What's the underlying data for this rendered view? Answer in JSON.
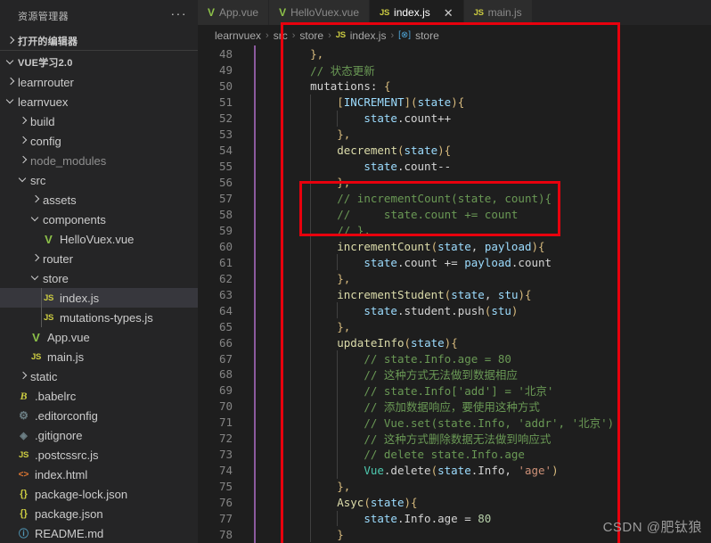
{
  "sidebar": {
    "header_title": "资源管理器",
    "dots_label": "···",
    "open_editors_label": "打开的编辑器",
    "project_label": "VUE学习2.0",
    "tree": [
      {
        "label": "learnrouter",
        "depth": 1,
        "kind": "folder",
        "state": "collapsed"
      },
      {
        "label": "learnvuex",
        "depth": 1,
        "kind": "folder",
        "state": "expanded"
      },
      {
        "label": "build",
        "depth": 2,
        "kind": "folder",
        "state": "collapsed"
      },
      {
        "label": "config",
        "depth": 2,
        "kind": "folder",
        "state": "collapsed"
      },
      {
        "label": "node_modules",
        "depth": 2,
        "kind": "folder",
        "state": "collapsed",
        "dim": true
      },
      {
        "label": "src",
        "depth": 2,
        "kind": "folder",
        "state": "expanded"
      },
      {
        "label": "assets",
        "depth": 3,
        "kind": "folder",
        "state": "collapsed"
      },
      {
        "label": "components",
        "depth": 3,
        "kind": "folder",
        "state": "expanded"
      },
      {
        "label": "HelloVuex.vue",
        "depth": 4,
        "kind": "file",
        "icon": "vue"
      },
      {
        "label": "router",
        "depth": 3,
        "kind": "folder",
        "state": "collapsed"
      },
      {
        "label": "store",
        "depth": 3,
        "kind": "folder",
        "state": "expanded"
      },
      {
        "label": "index.js",
        "depth": 4,
        "kind": "file",
        "icon": "js",
        "selected": true
      },
      {
        "label": "mutations-types.js",
        "depth": 4,
        "kind": "file",
        "icon": "js"
      },
      {
        "label": "App.vue",
        "depth": 3,
        "kind": "file",
        "icon": "vue"
      },
      {
        "label": "main.js",
        "depth": 3,
        "kind": "file",
        "icon": "js"
      },
      {
        "label": "static",
        "depth": 2,
        "kind": "folder",
        "state": "collapsed"
      },
      {
        "label": ".babelrc",
        "depth": 2,
        "kind": "file",
        "icon": "babel"
      },
      {
        "label": ".editorconfig",
        "depth": 2,
        "kind": "file",
        "icon": "gear"
      },
      {
        "label": ".gitignore",
        "depth": 2,
        "kind": "file",
        "icon": "git"
      },
      {
        "label": ".postcssrc.js",
        "depth": 2,
        "kind": "file",
        "icon": "js"
      },
      {
        "label": "index.html",
        "depth": 2,
        "kind": "file",
        "icon": "html"
      },
      {
        "label": "package-lock.json",
        "depth": 2,
        "kind": "file",
        "icon": "json"
      },
      {
        "label": "package.json",
        "depth": 2,
        "kind": "file",
        "icon": "json"
      },
      {
        "label": "README.md",
        "depth": 2,
        "kind": "file",
        "icon": "md"
      }
    ],
    "icon_glyphs": {
      "js": "JS",
      "vue": "V",
      "babel": "B",
      "gear": "⚙",
      "git": "◈",
      "html": "<>",
      "json": "{}",
      "md": "ⓘ"
    }
  },
  "tabs": [
    {
      "label": "App.vue",
      "icon": "vue",
      "icon_glyph": "V",
      "active": false,
      "closable": false
    },
    {
      "label": "HelloVuex.vue",
      "icon": "vue",
      "icon_glyph": "V",
      "active": false,
      "closable": false
    },
    {
      "label": "index.js",
      "icon": "js",
      "icon_glyph": "JS",
      "active": true,
      "closable": true,
      "close_glyph": "✕"
    },
    {
      "label": "main.js",
      "icon": "js",
      "icon_glyph": "JS",
      "active": false,
      "closable": false
    }
  ],
  "breadcrumb": {
    "items": [
      "learnvuex",
      "src",
      "store",
      "index.js",
      "store"
    ],
    "separator": "›",
    "file_icon_glyph": "JS",
    "symbol_icon_glyph": "[⊗]"
  },
  "editor": {
    "first_line": 48,
    "last_line": 78,
    "lines": [
      {
        "n": 48,
        "indent": 2,
        "tokens": [
          {
            "t": "},",
            "c": "c-brace"
          }
        ]
      },
      {
        "n": 49,
        "indent": 2,
        "tokens": [
          {
            "t": "// 状态更新",
            "c": "c-com"
          }
        ]
      },
      {
        "n": 50,
        "indent": 2,
        "tokens": [
          {
            "t": "mutations",
            "c": "c-plain"
          },
          {
            "t": ": ",
            "c": "c-plain"
          },
          {
            "t": "{",
            "c": "c-brace"
          }
        ]
      },
      {
        "n": 51,
        "indent": 3,
        "tokens": [
          {
            "t": "[",
            "c": "c-brace"
          },
          {
            "t": "INCREMENT",
            "c": "c-var"
          },
          {
            "t": "]",
            "c": "c-brace"
          },
          {
            "t": "(",
            "c": "c-brace"
          },
          {
            "t": "state",
            "c": "c-var"
          },
          {
            "t": ")",
            "c": "c-brace"
          },
          {
            "t": "{",
            "c": "c-brace"
          }
        ]
      },
      {
        "n": 52,
        "indent": 4,
        "tokens": [
          {
            "t": "state",
            "c": "c-var"
          },
          {
            "t": ".count++",
            "c": "c-plain"
          }
        ]
      },
      {
        "n": 53,
        "indent": 3,
        "tokens": [
          {
            "t": "},",
            "c": "c-brace"
          }
        ]
      },
      {
        "n": 54,
        "indent": 3,
        "tokens": [
          {
            "t": "decrement",
            "c": "c-func"
          },
          {
            "t": "(",
            "c": "c-brace"
          },
          {
            "t": "state",
            "c": "c-var"
          },
          {
            "t": ")",
            "c": "c-brace"
          },
          {
            "t": "{",
            "c": "c-brace"
          }
        ]
      },
      {
        "n": 55,
        "indent": 4,
        "tokens": [
          {
            "t": "state",
            "c": "c-var"
          },
          {
            "t": ".count--",
            "c": "c-plain"
          }
        ]
      },
      {
        "n": 56,
        "indent": 3,
        "tokens": [
          {
            "t": "},",
            "c": "c-brace"
          }
        ]
      },
      {
        "n": 57,
        "indent": 3,
        "tokens": [
          {
            "t": "// incrementCount(state, count){",
            "c": "c-com"
          }
        ]
      },
      {
        "n": 58,
        "indent": 3,
        "tokens": [
          {
            "t": "//     state.count += count",
            "c": "c-com"
          }
        ]
      },
      {
        "n": 59,
        "indent": 3,
        "tokens": [
          {
            "t": "// },",
            "c": "c-com"
          }
        ]
      },
      {
        "n": 60,
        "indent": 3,
        "tokens": [
          {
            "t": "incrementCount",
            "c": "c-func"
          },
          {
            "t": "(",
            "c": "c-brace"
          },
          {
            "t": "state",
            "c": "c-var"
          },
          {
            "t": ", ",
            "c": "c-plain"
          },
          {
            "t": "payload",
            "c": "c-var"
          },
          {
            "t": ")",
            "c": "c-brace"
          },
          {
            "t": "{",
            "c": "c-brace"
          }
        ]
      },
      {
        "n": 61,
        "indent": 4,
        "tokens": [
          {
            "t": "state",
            "c": "c-var"
          },
          {
            "t": ".count += ",
            "c": "c-plain"
          },
          {
            "t": "payload",
            "c": "c-var"
          },
          {
            "t": ".count",
            "c": "c-plain"
          }
        ]
      },
      {
        "n": 62,
        "indent": 3,
        "tokens": [
          {
            "t": "},",
            "c": "c-brace"
          }
        ]
      },
      {
        "n": 63,
        "indent": 3,
        "tokens": [
          {
            "t": "incrementStudent",
            "c": "c-func"
          },
          {
            "t": "(",
            "c": "c-brace"
          },
          {
            "t": "state",
            "c": "c-var"
          },
          {
            "t": ", ",
            "c": "c-plain"
          },
          {
            "t": "stu",
            "c": "c-var"
          },
          {
            "t": ")",
            "c": "c-brace"
          },
          {
            "t": "{",
            "c": "c-brace"
          }
        ]
      },
      {
        "n": 64,
        "indent": 4,
        "tokens": [
          {
            "t": "state",
            "c": "c-var"
          },
          {
            "t": ".student.",
            "c": "c-plain"
          },
          {
            "t": "push",
            "c": "c-plain"
          },
          {
            "t": "(",
            "c": "c-brace"
          },
          {
            "t": "stu",
            "c": "c-var"
          },
          {
            "t": ")",
            "c": "c-brace"
          }
        ]
      },
      {
        "n": 65,
        "indent": 3,
        "tokens": [
          {
            "t": "},",
            "c": "c-brace"
          }
        ]
      },
      {
        "n": 66,
        "indent": 3,
        "tokens": [
          {
            "t": "updateInfo",
            "c": "c-func"
          },
          {
            "t": "(",
            "c": "c-brace"
          },
          {
            "t": "state",
            "c": "c-var"
          },
          {
            "t": ")",
            "c": "c-brace"
          },
          {
            "t": "{",
            "c": "c-brace"
          }
        ]
      },
      {
        "n": 67,
        "indent": 4,
        "tokens": [
          {
            "t": "// state.Info.age = 80",
            "c": "c-com"
          }
        ]
      },
      {
        "n": 68,
        "indent": 4,
        "tokens": [
          {
            "t": "// 这种方式无法做到数据相应",
            "c": "c-com"
          }
        ]
      },
      {
        "n": 69,
        "indent": 4,
        "tokens": [
          {
            "t": "// state.Info['add'] = '北京'",
            "c": "c-com"
          }
        ]
      },
      {
        "n": 70,
        "indent": 4,
        "tokens": [
          {
            "t": "// 添加数据响应，要使用这种方式",
            "c": "c-com"
          }
        ]
      },
      {
        "n": 71,
        "indent": 4,
        "tokens": [
          {
            "t": "// Vue.set(state.Info, 'addr', '北京')",
            "c": "c-com"
          }
        ]
      },
      {
        "n": 72,
        "indent": 4,
        "tokens": [
          {
            "t": "// 这种方式删除数据无法做到响应式",
            "c": "c-com"
          }
        ]
      },
      {
        "n": 73,
        "indent": 4,
        "tokens": [
          {
            "t": "// delete state.Info.age",
            "c": "c-com"
          }
        ]
      },
      {
        "n": 74,
        "indent": 4,
        "tokens": [
          {
            "t": "Vue",
            "c": "c-cls"
          },
          {
            "t": ".",
            "c": "c-plain"
          },
          {
            "t": "delete",
            "c": "c-plain"
          },
          {
            "t": "(",
            "c": "c-brace"
          },
          {
            "t": "state",
            "c": "c-var"
          },
          {
            "t": ".Info, ",
            "c": "c-plain"
          },
          {
            "t": "'age'",
            "c": "c-str"
          },
          {
            "t": ")",
            "c": "c-brace"
          }
        ]
      },
      {
        "n": 75,
        "indent": 3,
        "tokens": [
          {
            "t": "},",
            "c": "c-brace"
          }
        ]
      },
      {
        "n": 76,
        "indent": 3,
        "tokens": [
          {
            "t": "Asyc",
            "c": "c-func"
          },
          {
            "t": "(",
            "c": "c-brace"
          },
          {
            "t": "state",
            "c": "c-var"
          },
          {
            "t": ")",
            "c": "c-brace"
          },
          {
            "t": "{",
            "c": "c-brace"
          }
        ]
      },
      {
        "n": 77,
        "indent": 4,
        "tokens": [
          {
            "t": "state",
            "c": "c-var"
          },
          {
            "t": ".Info.age = ",
            "c": "c-plain"
          },
          {
            "t": "80",
            "c": "c-num"
          }
        ]
      },
      {
        "n": 78,
        "indent": 3,
        "tokens": [
          {
            "t": "}",
            "c": "c-brace"
          }
        ]
      }
    ]
  },
  "annotations": {
    "outer_box_color": "#e8000d",
    "inner_box_color": "#e8000d"
  },
  "watermark": "CSDN @肥钛狼"
}
